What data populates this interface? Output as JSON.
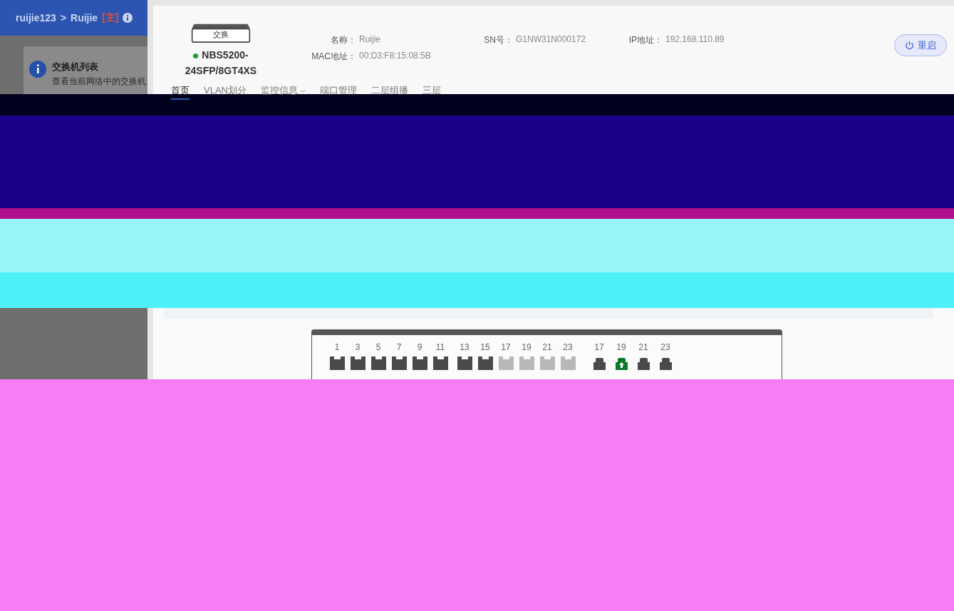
{
  "breadcrumb": {
    "account": "ruijie123",
    "separator": ">",
    "device": "Ruijie",
    "role_tag": "[主]"
  },
  "notice": {
    "title": "交换机列表",
    "text": "查看当前网络中的交换机"
  },
  "device": {
    "icon_label": "交换",
    "online": true,
    "model": "NBS5200-24SFP/8GT4XS",
    "fields": [
      {
        "label": "名称：",
        "value": "Ruijie"
      },
      {
        "label": "SN号：",
        "value": "G1NW31N000172"
      },
      {
        "label": "IP地址：",
        "value": "192.168.110.89"
      },
      {
        "label": "MAC地址：",
        "value": "00:D3:F8:15:08:5B"
      }
    ]
  },
  "restart_button": "重启",
  "tabs": [
    {
      "label": "首页",
      "selected": true,
      "dropdown": false
    },
    {
      "label": "VLAN划分",
      "selected": false,
      "dropdown": false
    },
    {
      "label": "监控信息",
      "selected": false,
      "dropdown": true
    },
    {
      "label": "端口管理",
      "selected": false,
      "dropdown": false
    },
    {
      "label": "二层组播",
      "selected": false,
      "dropdown": false
    },
    {
      "label": "三层",
      "selected": false,
      "dropdown": false
    }
  ],
  "port_groups": [
    {
      "kind": "sfp",
      "ports": [
        {
          "number": "1",
          "disabled": false,
          "uplink": false
        },
        {
          "number": "3",
          "disabled": false,
          "uplink": false
        },
        {
          "number": "5",
          "disabled": false,
          "uplink": false
        },
        {
          "number": "7",
          "disabled": false,
          "uplink": false
        },
        {
          "number": "9",
          "disabled": false,
          "uplink": false
        },
        {
          "number": "11",
          "disabled": false,
          "uplink": false
        }
      ]
    },
    {
      "kind": "sfp",
      "ports": [
        {
          "number": "13",
          "disabled": false,
          "uplink": false
        },
        {
          "number": "15",
          "disabled": false,
          "uplink": false
        },
        {
          "number": "17",
          "disabled": true,
          "uplink": false
        },
        {
          "number": "19",
          "disabled": true,
          "uplink": false
        },
        {
          "number": "21",
          "disabled": true,
          "uplink": false
        },
        {
          "number": "23",
          "disabled": true,
          "uplink": false
        }
      ]
    },
    {
      "kind": "rj45",
      "ports": [
        {
          "number": "17",
          "disabled": false,
          "uplink": false
        },
        {
          "number": "19",
          "disabled": false,
          "uplink": true
        },
        {
          "number": "21",
          "disabled": false,
          "uplink": false
        },
        {
          "number": "23",
          "disabled": false,
          "uplink": false
        }
      ]
    }
  ]
}
